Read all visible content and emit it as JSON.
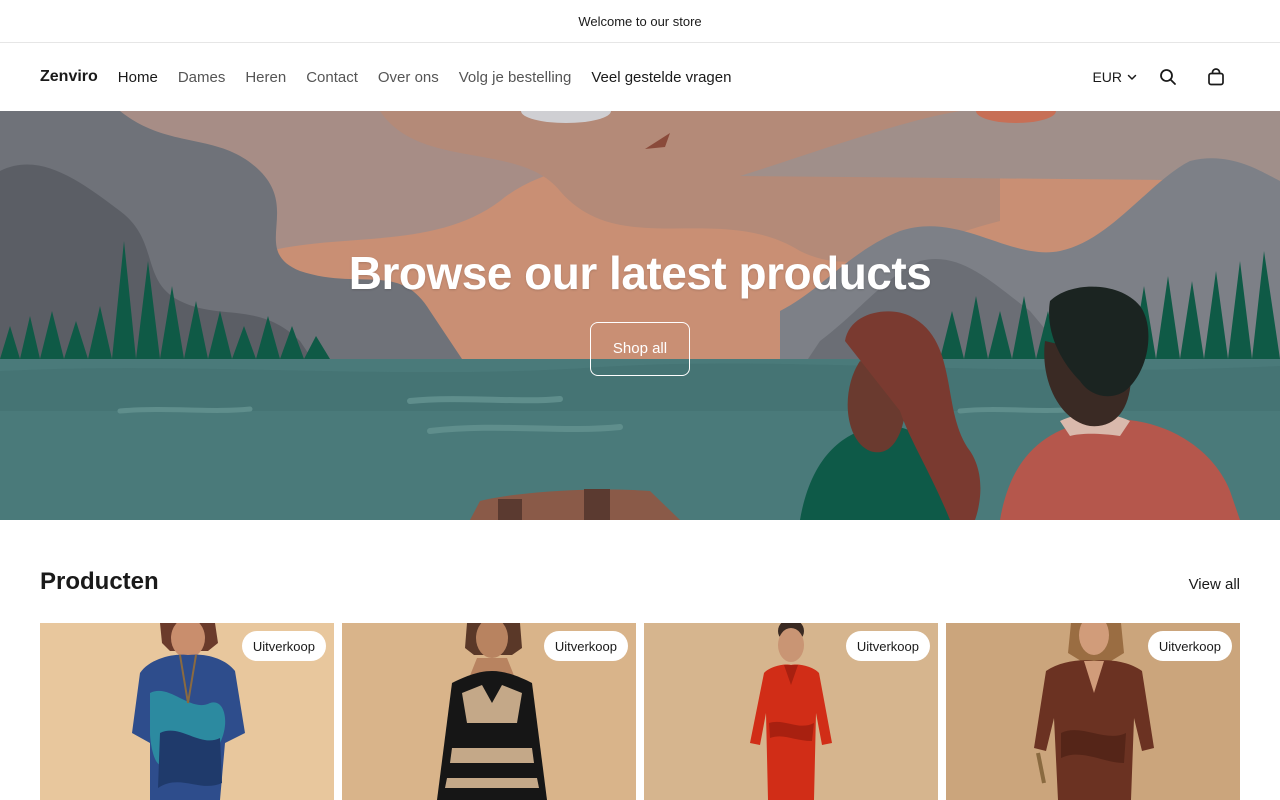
{
  "announcement": "Welcome to our store",
  "header": {
    "logo": "Zenviro",
    "nav": [
      {
        "label": "Home"
      },
      {
        "label": "Dames"
      },
      {
        "label": "Heren"
      },
      {
        "label": "Contact"
      },
      {
        "label": "Over ons"
      },
      {
        "label": "Volg je bestelling"
      },
      {
        "label": "Veel gestelde vragen"
      }
    ],
    "currency": "EUR",
    "icons": {
      "search": "search-icon",
      "cart": "shopping-bag-icon",
      "currency_arrow": "chevron-down-icon"
    }
  },
  "hero": {
    "title": "Browse our latest products",
    "button": "Shop all",
    "colors": {
      "sky": "#c98f74",
      "mountains": "#7b7e85",
      "trees": "#0f5a46",
      "lake": "#4a7a7a"
    }
  },
  "products": {
    "title": "Producten",
    "view_all": "View all",
    "items": [
      {
        "badge": "Uitverkoop",
        "image": "woman-in-blue-abstract-print-dress"
      },
      {
        "badge": "Uitverkoop",
        "image": "woman-in-black-halter-dress"
      },
      {
        "badge": "Uitverkoop",
        "image": "woman-in-red-wrap-dress"
      },
      {
        "badge": "Uitverkoop",
        "image": "woman-in-brown-satin-dress"
      }
    ]
  }
}
